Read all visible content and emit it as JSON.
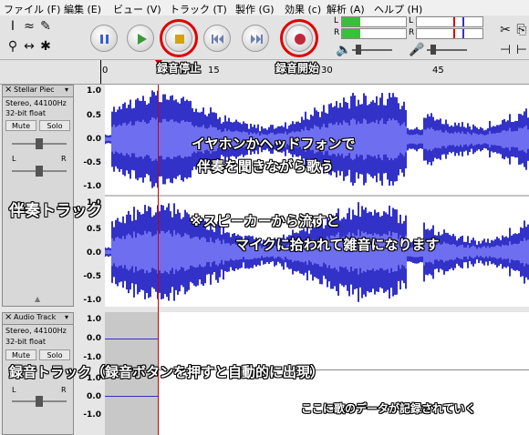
{
  "menu": [
    "ファイル (F)",
    "編集 (E)",
    "ビュー (V)",
    "トラック (T)",
    "製作 (G)",
    "効果 (c)",
    "解析 (A)",
    "ヘルプ (H)"
  ],
  "meters": {
    "left": "L",
    "right": "R"
  },
  "ruler": {
    "ticks": [
      "0",
      "15",
      "30",
      "45"
    ]
  },
  "tracks": [
    {
      "name": "Stellar Piec",
      "info1": "Stereo, 44100Hz",
      "info2": "32-bit float",
      "mute": "Mute",
      "solo": "Solo",
      "pan_l": "L",
      "pan_r": "R",
      "scale": [
        "1.0",
        "0.5",
        "0.0",
        "-0.5",
        "-1.0",
        "1.0",
        "0.5",
        "0.0",
        "-0.5",
        "-1.0"
      ]
    },
    {
      "name": "Audio Track",
      "info1": "Stereo, 44100Hz",
      "info2": "32-bit float",
      "mute": "Mute",
      "solo": "Solo",
      "pan_l": "L",
      "pan_r": "R",
      "scale": [
        "1.0",
        "0.0",
        "-1.0",
        "1.0",
        "0.0",
        "-1.0"
      ]
    }
  ],
  "annotations": {
    "stop": "録音停止",
    "record": "録音開始",
    "earphone_line1": "イヤホンかヘッドフォンで",
    "earphone_line2": "伴奏を聞きながら歌う",
    "backing": "伴奏トラック",
    "speaker_line1": "※スピーカーから流すと",
    "speaker_line2": "マイクに拾われて雑音になります",
    "rec_track": "録音トラック（録音ボタンを押すと自動的に出現）",
    "data": "ここに歌のデータが記録されていく"
  },
  "colors": {
    "wave_dark": "#3232c8",
    "wave_light": "#6e6ef0",
    "playhead": "#d00000",
    "ring": "#e00000"
  }
}
